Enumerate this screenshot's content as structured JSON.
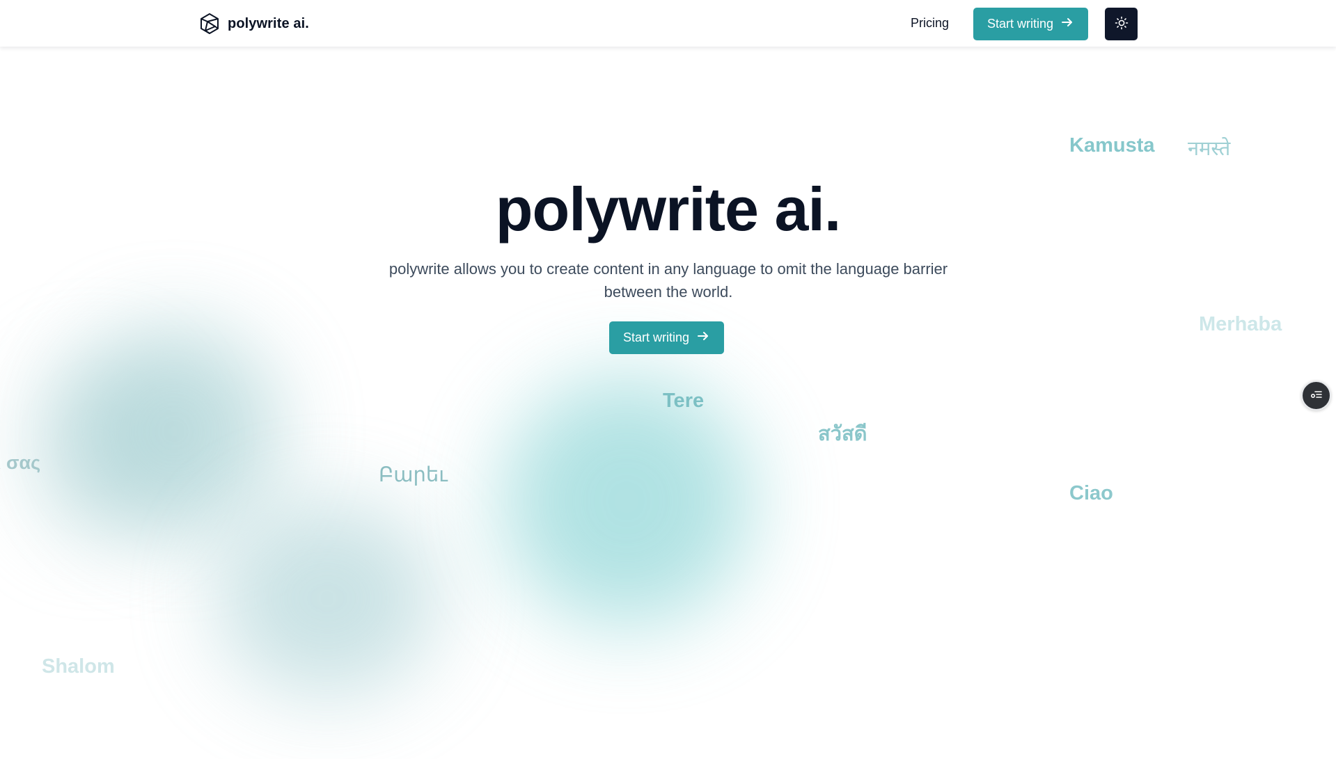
{
  "navbar": {
    "brand": {
      "name": "polywrite ai.",
      "icon": "polyhedron-logo-icon"
    },
    "pricing_label": "Pricing",
    "cta_label": "Start writing",
    "cta_icon": "arrow-right-icon",
    "theme_toggle_icon": "sun-icon"
  },
  "hero": {
    "title": "polywrite ai.",
    "subtitle_line1": "polywrite allows you to create content in any language to omit the language barrier",
    "subtitle_line2": "between the world.",
    "cta_label": "Start writing",
    "cta_icon": "arrow-right-icon"
  },
  "greetings": {
    "kamusta": "Kamusta",
    "namaste": "नमस्ते",
    "merhaba": "Merhaba",
    "tere": "Tere",
    "sawatdee": "สวัสดี",
    "barev": "Բարեւ",
    "ciao": "Ciao",
    "shalom": "Shalom",
    "greek_partial": "ι σας"
  },
  "side_action": {
    "icon": "list-settings-icon"
  },
  "colors": {
    "accent": "#2a9ea3",
    "dark": "#0f172a",
    "text": "#0b1324",
    "muted_text": "#3d4b5c"
  }
}
